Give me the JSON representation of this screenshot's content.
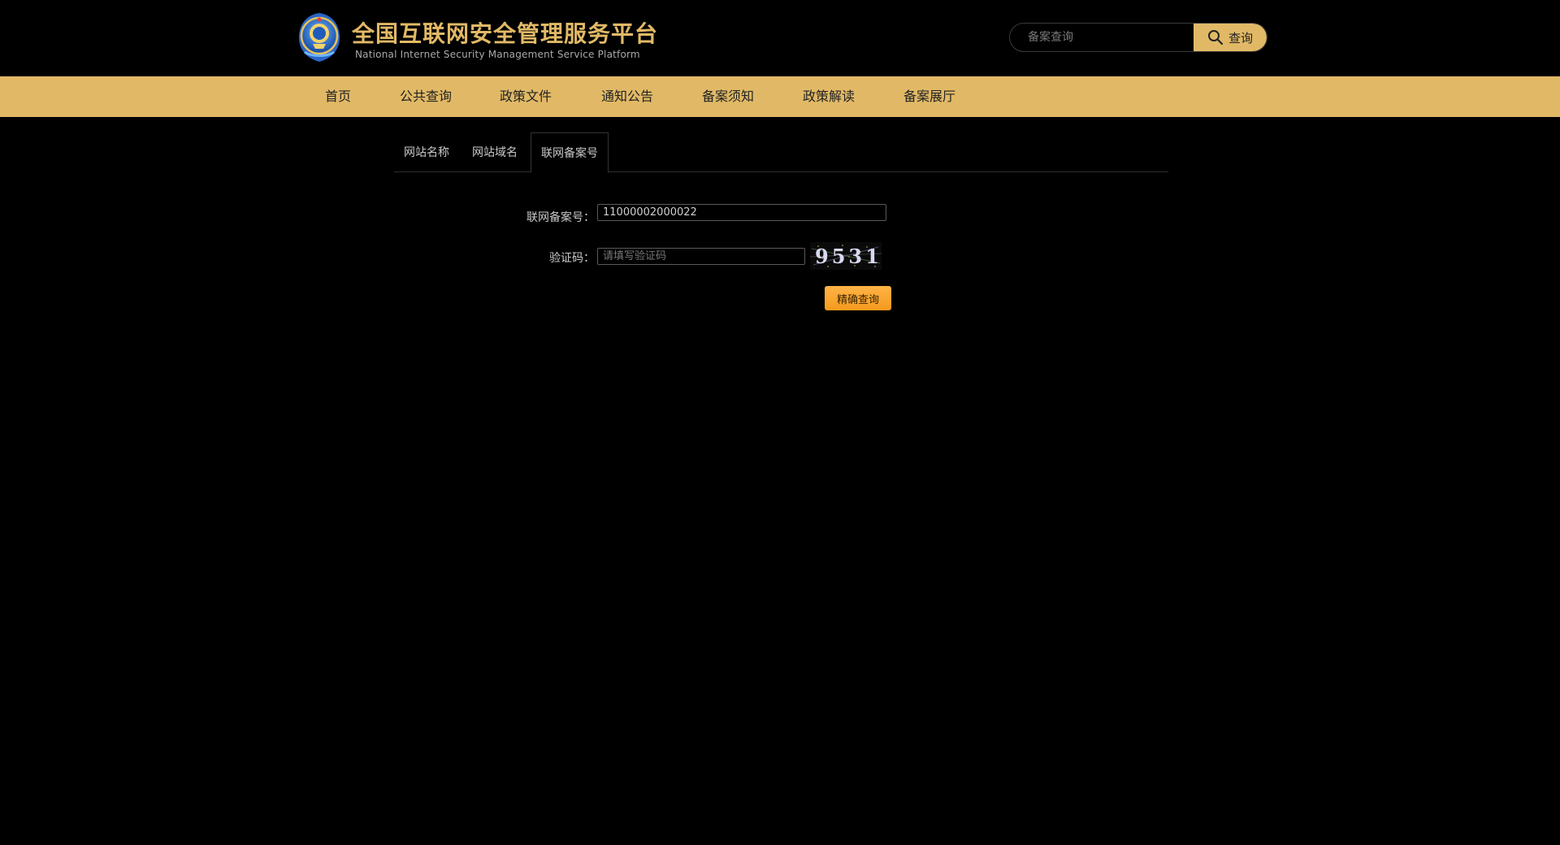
{
  "header": {
    "title": "全国互联网安全管理服务平台",
    "subtitle": "National Internet Security Management Service Platform",
    "logo_icon": "police-emblem-icon",
    "search": {
      "placeholder": "备案查询",
      "value": "",
      "button_label": "查询",
      "button_icon": "search-icon"
    }
  },
  "nav": {
    "items": [
      {
        "label": "首页"
      },
      {
        "label": "公共查询"
      },
      {
        "label": "政策文件"
      },
      {
        "label": "通知公告"
      },
      {
        "label": "备案须知"
      },
      {
        "label": "政策解读"
      },
      {
        "label": "备案展厅"
      }
    ]
  },
  "tabs": {
    "items": [
      {
        "label": "网站名称",
        "active": false
      },
      {
        "label": "网站域名",
        "active": false
      },
      {
        "label": "联网备案号",
        "active": true
      }
    ]
  },
  "form": {
    "record_label": "联网备案号：",
    "record_value": "11000002000022",
    "captcha_label": "验证码：",
    "captcha_placeholder": "请填写验证码",
    "captcha_value": "",
    "captcha_text": "9531",
    "submit_label": "精确查询"
  },
  "colors": {
    "accent": "#e1b966",
    "background": "#000000",
    "submit": "#f5a23a"
  }
}
